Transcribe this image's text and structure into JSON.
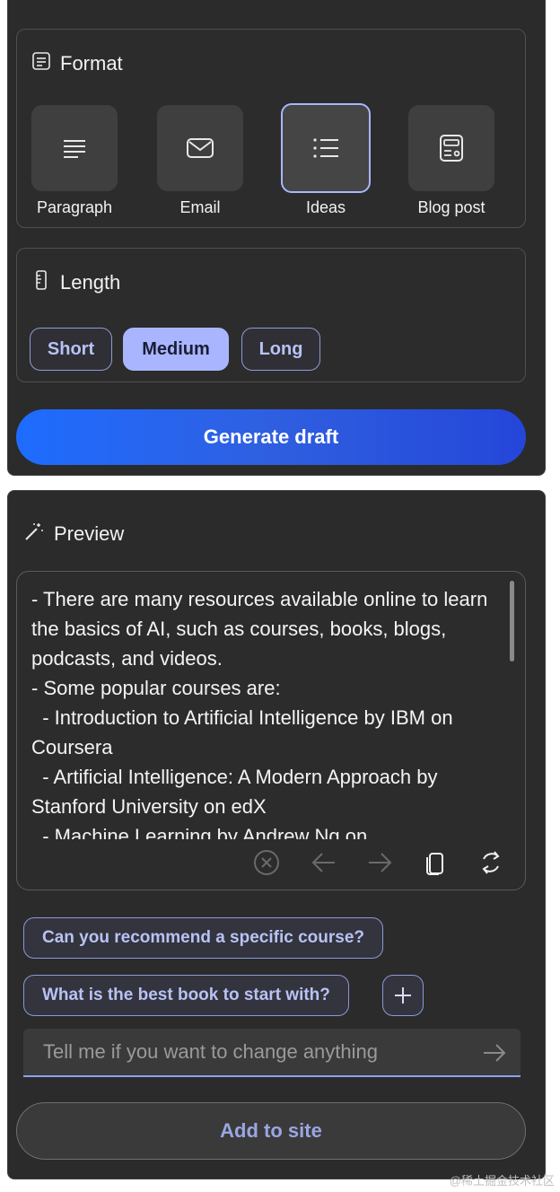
{
  "format": {
    "title": "Format",
    "options": [
      {
        "label": "Paragraph",
        "icon": "paragraph-icon"
      },
      {
        "label": "Email",
        "icon": "email-icon"
      },
      {
        "label": "Ideas",
        "icon": "list-icon",
        "selected": true
      },
      {
        "label": "Blog post",
        "icon": "blog-post-icon"
      }
    ]
  },
  "length": {
    "title": "Length",
    "options": [
      {
        "label": "Short"
      },
      {
        "label": "Medium",
        "selected": true
      },
      {
        "label": "Long"
      }
    ]
  },
  "generate": {
    "label": "Generate draft"
  },
  "preview": {
    "title": "Preview",
    "text": "- There are many resources available online to learn the basics of AI, such as courses, books, blogs, podcasts, and videos.\n- Some popular courses are:\n  - Introduction to Artificial Intelligence by IBM on Coursera\n  - Artificial Intelligence: A Modern Approach by Stanford University on edX\n  - Machine Learning by Andrew Ng on",
    "tools": [
      "stop-icon",
      "back-arrow-icon",
      "forward-arrow-icon",
      "copy-icon",
      "regenerate-icon"
    ]
  },
  "suggestions": [
    {
      "label": "Can you recommend a specific course?"
    },
    {
      "label": "What is the best book to start with?"
    }
  ],
  "input": {
    "placeholder": "Tell me if you want to change anything"
  },
  "add_to_site": {
    "label": "Add to site"
  },
  "watermark": "@稀土掘金技术社区",
  "colors": {
    "accent": "#a9b6ff",
    "primary_gradient_start": "#1e6cff",
    "panel_bg": "#2b2b2b"
  }
}
